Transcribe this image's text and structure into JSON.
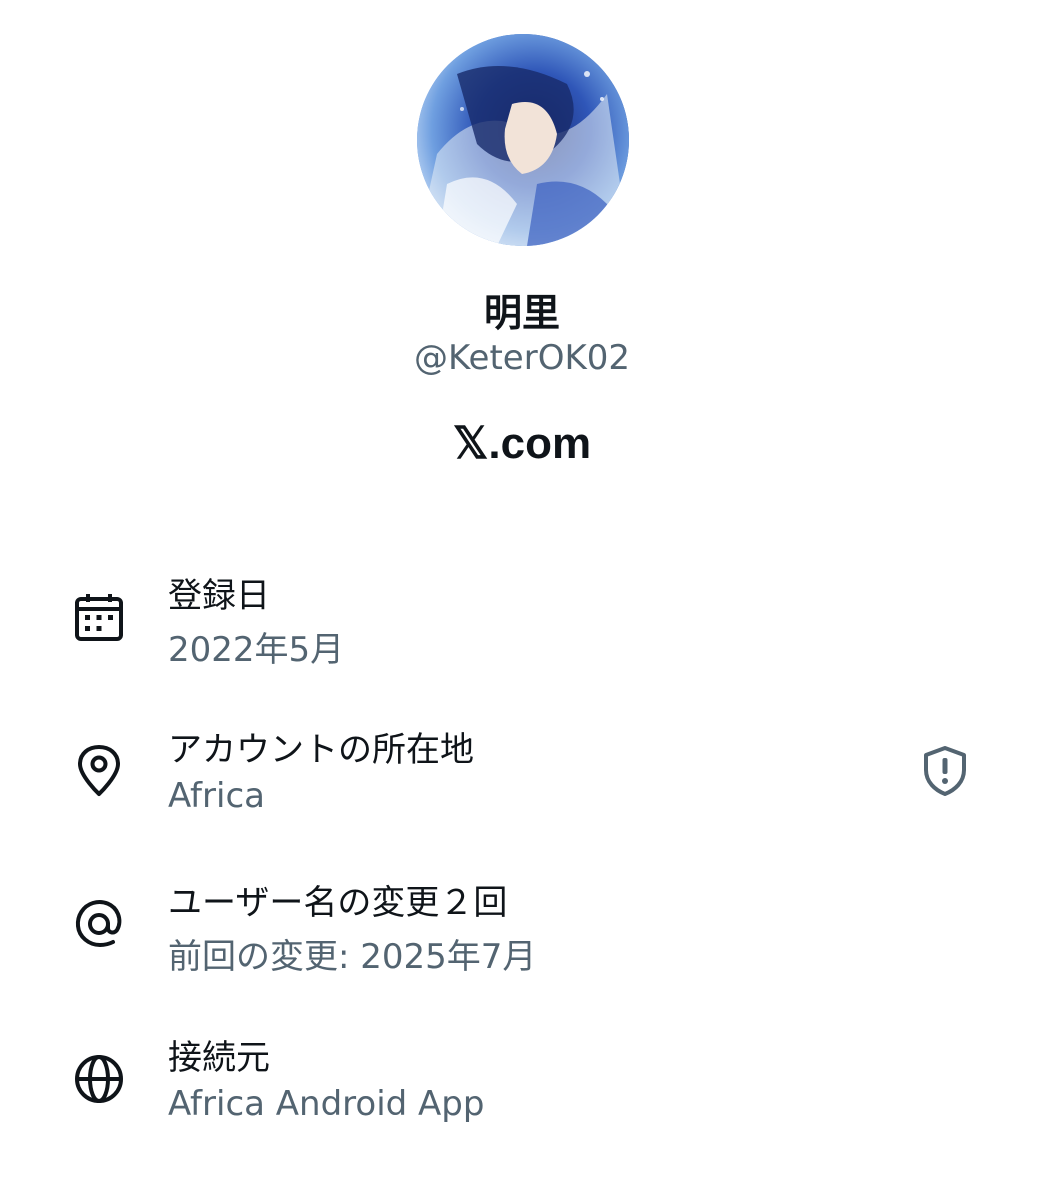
{
  "profile": {
    "display_name": "明里",
    "handle": "@KeterOK02",
    "brand": "𝕏.com"
  },
  "details": [
    {
      "icon": "calendar-icon",
      "label": "登録日",
      "value": "2022年5月"
    },
    {
      "icon": "location-pin-icon",
      "label": "アカウントの所在地",
      "value": "Africa",
      "trailing_icon": "shield-alert-icon"
    },
    {
      "icon": "at-sign-icon",
      "label": "ユーザー名の変更２回",
      "value": "前回の変更: 2025年7月"
    },
    {
      "icon": "globe-icon",
      "label": "接続元",
      "value": "Africa Android App"
    }
  ],
  "colors": {
    "primary_text": "#0f1419",
    "secondary_text": "#536471"
  }
}
